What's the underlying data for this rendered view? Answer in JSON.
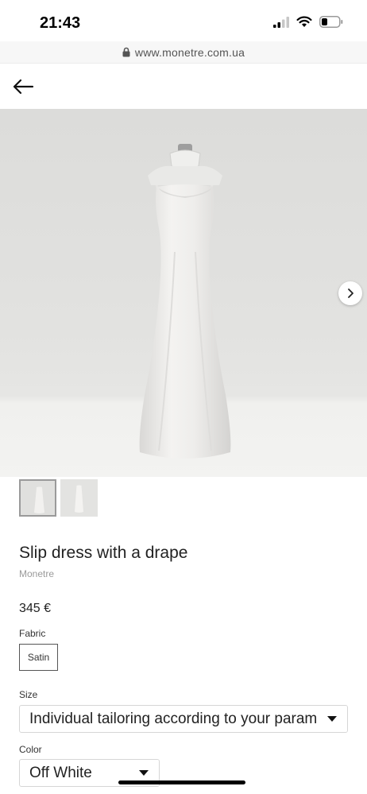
{
  "status_bar": {
    "time": "21:43",
    "icons": [
      "signal-icon",
      "wifi-icon",
      "battery-icon"
    ]
  },
  "browser": {
    "url": "www.monetre.com.ua",
    "lock_icon": "lock-icon"
  },
  "nav": {
    "back_icon": "arrow-left-icon"
  },
  "gallery": {
    "image_count": 2,
    "active_index": 0,
    "next_icon": "chevron-right-icon"
  },
  "product": {
    "title": "Slip dress with a drape",
    "brand": "Monetre",
    "price": "345 €"
  },
  "options": {
    "fabric": {
      "label": "Fabric",
      "selected": "Satin"
    },
    "size": {
      "label": "Size",
      "selected": "Individual tailoring according to your parameters"
    },
    "color": {
      "label": "Color",
      "selected": "Off White"
    }
  },
  "colors": {
    "accent_text": "#222222",
    "muted_text": "#9a9a9a",
    "image_background": "#e2e2e0"
  }
}
